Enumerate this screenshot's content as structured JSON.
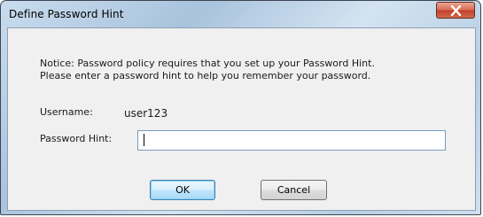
{
  "window": {
    "title": "Define Password Hint",
    "close_icon": "close-x-icon"
  },
  "notice": {
    "line1": "Notice: Password policy requires that you set up your Password Hint.",
    "line2": "Please enter a password hint to help you remember your password."
  },
  "fields": {
    "username_label": "Username:",
    "username_value": "user123",
    "hint_label": "Password Hint:",
    "hint_value": ""
  },
  "buttons": {
    "ok_label": "OK",
    "cancel_label": "Cancel"
  },
  "colors": {
    "close_button": "#c2412a",
    "ok_button_border": "#3c7fb1",
    "input_border": "#7a9cc0",
    "dialog_background": "#f0f0f0"
  }
}
